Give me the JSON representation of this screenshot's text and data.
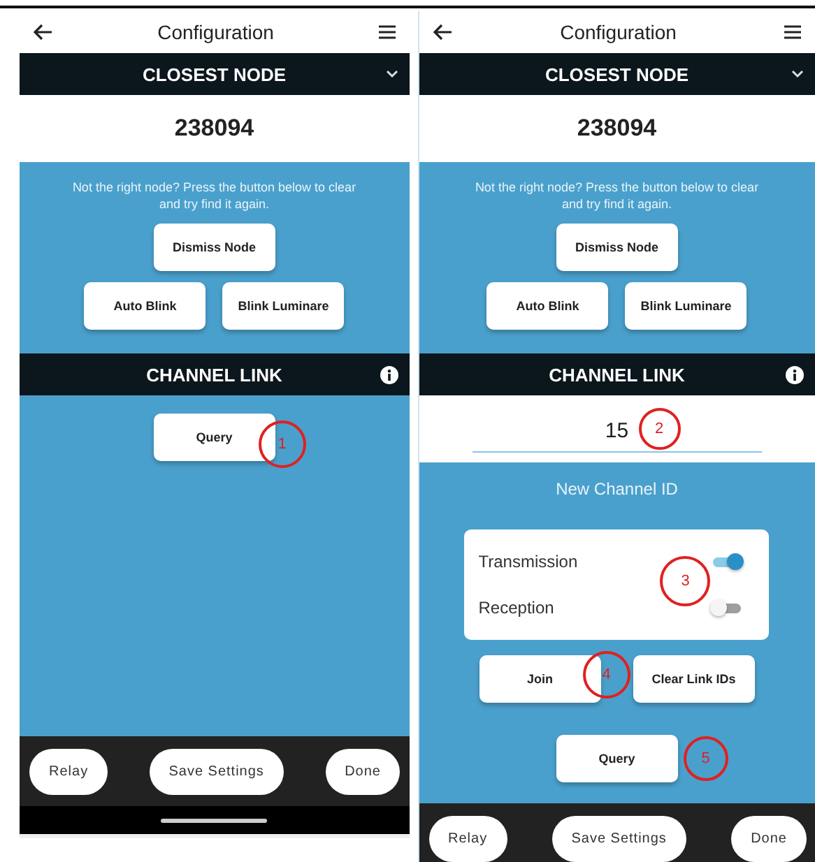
{
  "screens": [
    {
      "title": "Configuration",
      "closest_node": {
        "heading": "CLOSEST NODE",
        "value": "238094"
      },
      "message": "Not the right node? Press the button below to clear and try find it again.",
      "dismiss_button": "Dismiss Node",
      "node_buttons": [
        "Auto Blink",
        "Blink Luminare"
      ],
      "channel_link": {
        "heading": "CHANNEL LINK",
        "query": {
          "label": "Query",
          "annotation": "1"
        }
      },
      "footer_buttons": [
        "Relay",
        "Save Settings",
        "Done"
      ],
      "home_bar": true
    },
    {
      "title": "Configuration",
      "closest_node": {
        "heading": "CLOSEST NODE",
        "value": "238094"
      },
      "message": "Not the right node? Press the button below to clear and try find it again.",
      "dismiss_button": "Dismiss Node",
      "node_buttons": [
        "Auto Blink",
        "Blink Luminare"
      ],
      "channel_link": {
        "heading": "CHANNEL LINK",
        "channel_field": {
          "value": "15",
          "annotation": "2"
        },
        "field_label": "New Channel ID",
        "toggles_annotation": "3",
        "toggles": [
          {
            "label": "Transmission",
            "on": true
          },
          {
            "label": "Reception",
            "on": false
          }
        ],
        "link_buttons": [
          {
            "label": "Join",
            "annotation": "4"
          },
          {
            "label": "Clear Link IDs"
          }
        ],
        "query": {
          "label": "Query",
          "annotation": "5"
        }
      },
      "footer_buttons": [
        "Relay",
        "Save Settings",
        "Done"
      ],
      "home_bar": false
    }
  ]
}
